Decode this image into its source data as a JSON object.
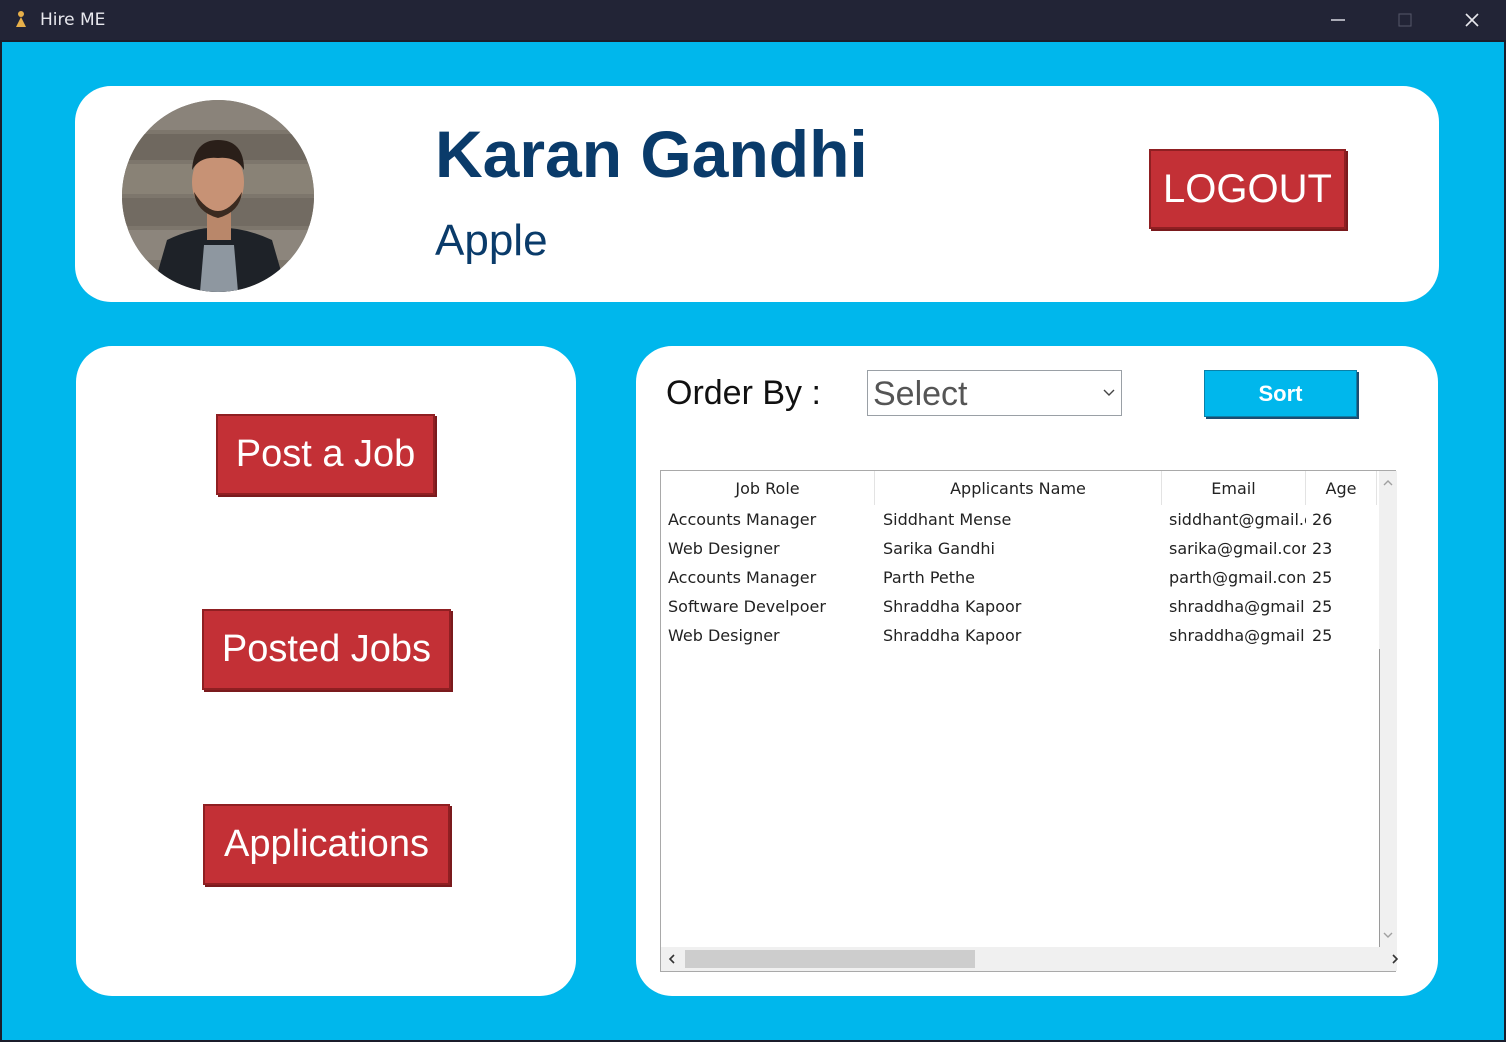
{
  "window": {
    "title": "Hire ME",
    "controls": {
      "minimize_icon": "minimize-icon",
      "maximize_icon": "maximize-icon",
      "close_icon": "close-icon"
    }
  },
  "header": {
    "name": "Karan Gandhi",
    "company": "Apple",
    "logout_label": "LOGOUT",
    "avatar_icon": "profile-photo"
  },
  "nav": {
    "post_job_label": "Post a Job",
    "posted_jobs_label": "Posted Jobs",
    "applications_label": "Applications"
  },
  "sort_panel": {
    "order_by_label": "Order By :",
    "select_value": "Select",
    "sort_label": "Sort"
  },
  "table": {
    "columns": [
      "Job Role",
      "Applicants Name",
      "Email",
      "Age"
    ],
    "rows": [
      [
        "Accounts Manager",
        "Siddhant Mense",
        "siddhant@gmail.c",
        "26"
      ],
      [
        "Web Designer",
        "Sarika Gandhi",
        "sarika@gmail.cor",
        "23"
      ],
      [
        "Accounts Manager",
        "Parth Pethe",
        "parth@gmail.con",
        "25"
      ],
      [
        "Software Develpoer",
        "Shraddha Kapoor",
        "shraddha@gmail.",
        "25"
      ],
      [
        "Web Designer",
        "Shraddha Kapoor",
        "shraddha@gmail.",
        "25"
      ]
    ]
  },
  "colors": {
    "background": "#00b7ec",
    "accent_red": "#c33036",
    "name_text": "#0a3b6a",
    "titlebar": "#222436"
  }
}
